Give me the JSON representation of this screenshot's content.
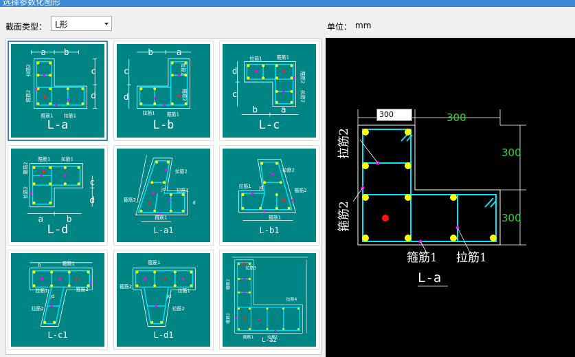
{
  "window": {
    "title": "选择参数化图形"
  },
  "toolbar": {
    "section_type_label": "截面类型：",
    "section_type_value": "L形",
    "unit_label": "单位：",
    "unit_value": "mm"
  },
  "shapes": [
    {
      "name": "L-a",
      "selected": true
    },
    {
      "name": "L-b",
      "selected": false
    },
    {
      "name": "L-c",
      "selected": false
    },
    {
      "name": "L-d",
      "selected": false
    },
    {
      "name": "L-a1",
      "selected": false
    },
    {
      "name": "L-b1",
      "selected": false
    },
    {
      "name": "L-c1",
      "selected": false
    },
    {
      "name": "L-d1",
      "selected": false
    },
    {
      "name": "L-a2",
      "selected": false
    }
  ],
  "thumb_labels": {
    "a": "a",
    "b": "b",
    "c": "c",
    "d": "d",
    "jd": "jd",
    "lajin1": "拉筋1",
    "lajin2": "拉筋2",
    "gujin1": "箍筋1",
    "gujin2": "箍筋2",
    "lajin3": "拉筋3",
    "lajin4": "拉筋4"
  },
  "preview": {
    "dim_input_value": "300",
    "dim_top": "300",
    "dim_right_upper": "300",
    "dim_right_lower": "300",
    "label_lajin2": "拉筋2",
    "label_gujin2": "箍筋2",
    "label_gujin1": "箍筋1",
    "label_lajin1": "拉筋1",
    "shape_name": "L-a"
  },
  "colors": {
    "tile_bg": "#008484",
    "rebar_line": "#00e5ff",
    "rebar_dot": "#ffff00",
    "marker": "#ff00ff",
    "dim_green": "#2bd82b",
    "selection": "#2f7fd8"
  }
}
